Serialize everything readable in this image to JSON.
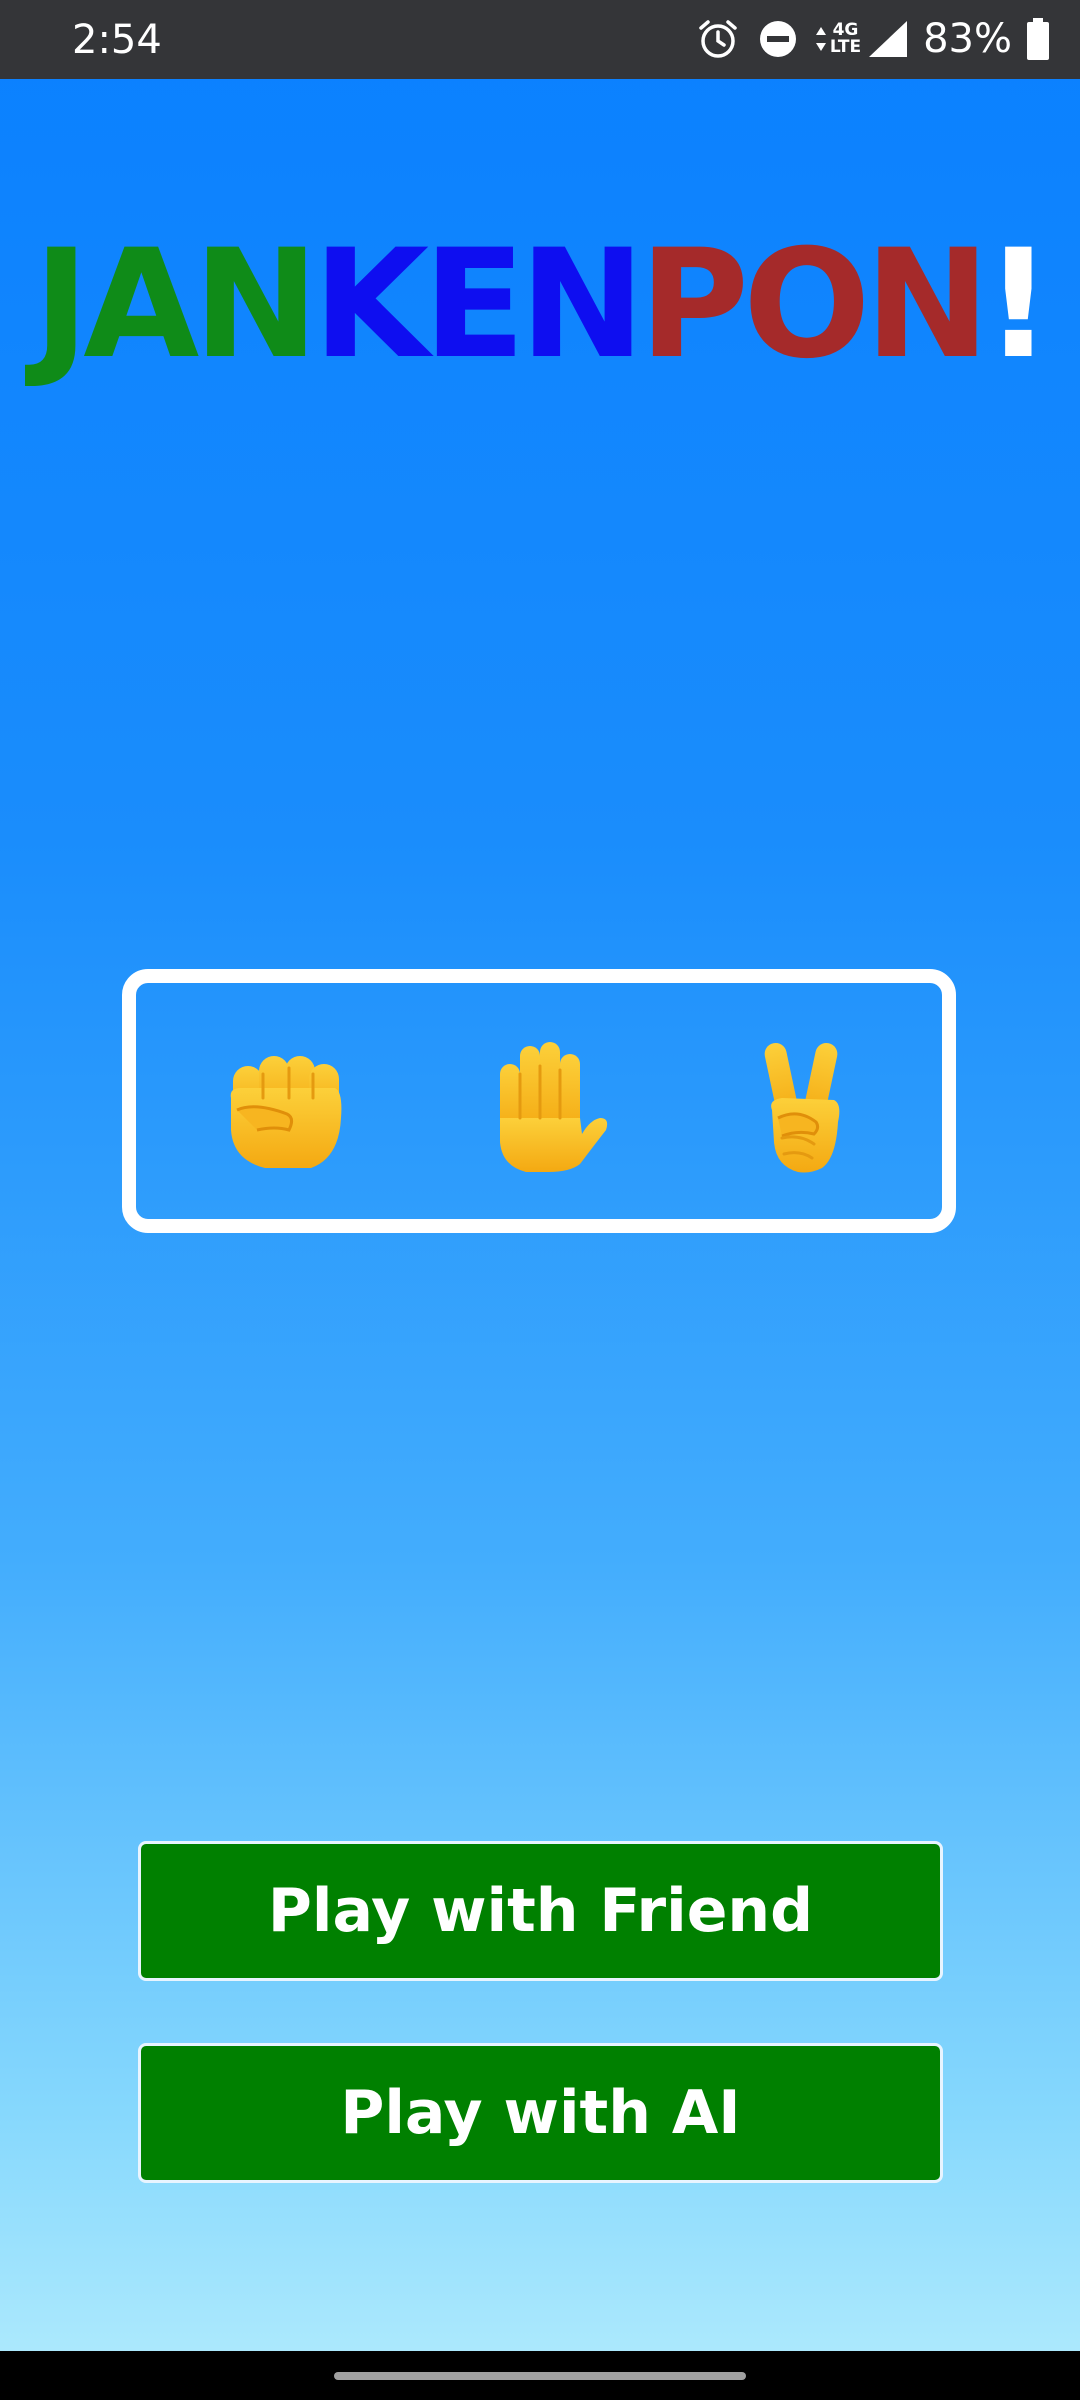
{
  "status_bar": {
    "time": "2:54",
    "network_top": "4G",
    "network_bottom": "LTE",
    "battery_percent": "83%",
    "icons": [
      "alarm-icon",
      "do-not-disturb-icon",
      "data-arrows-icon",
      "signal-icon",
      "battery-icon"
    ]
  },
  "title": {
    "part1": "JAN",
    "part2": "KEN",
    "part3": "PON",
    "part4": "!",
    "colors": {
      "jan": "#0f8b18",
      "ken": "#0e0ef0",
      "pon": "#a52a2a",
      "bang": "#ffffff"
    }
  },
  "choices": [
    {
      "name": "rock",
      "icon": "raised-fist-icon"
    },
    {
      "name": "paper",
      "icon": "raised-hand-icon"
    },
    {
      "name": "scissors",
      "icon": "victory-hand-icon"
    }
  ],
  "buttons": {
    "play_friend": "Play with Friend",
    "play_ai": "Play with AI"
  },
  "colors": {
    "button_bg": "#008000",
    "background_top": "#0a80ff",
    "background_bottom": "#b3ecfd",
    "emoji_yellow": "#f9c02b"
  }
}
